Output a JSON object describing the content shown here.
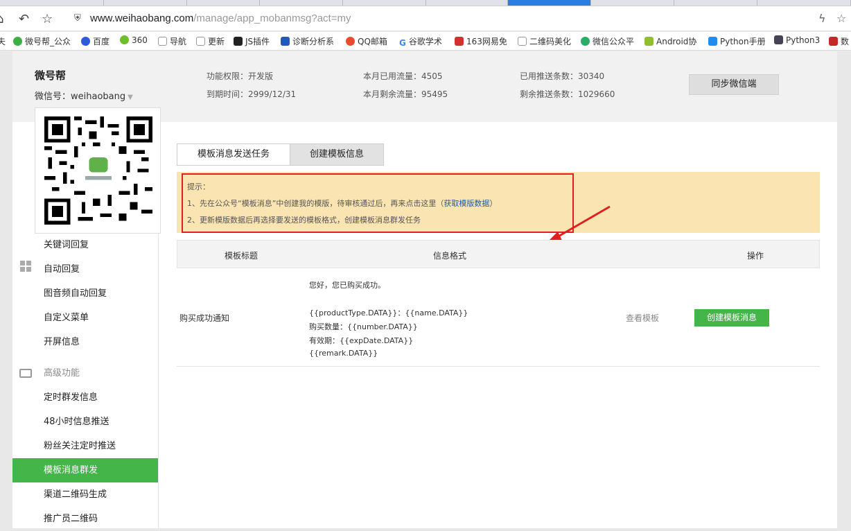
{
  "browser": {
    "url_host": "www.weihaobang.com",
    "url_path": "/manage/app_mobanmsg?act=my",
    "bookmarks": [
      "微号帮_公众",
      "百度",
      "360",
      "导航",
      "更新",
      "JS插件",
      "诊断分析系",
      "QQ邮箱",
      "谷歌学术",
      "163网易免",
      "二维码美化",
      "微信公众平",
      "Android协",
      "Python手册",
      "Python3",
      "数"
    ]
  },
  "header": {
    "brand": "微号帮",
    "wechat_id": "微信号：weihaobang",
    "permission": "功能权限：开发版",
    "expiry": "到期时间：2999/12/31",
    "used_traffic": "本月已用流量：4505",
    "remaining_traffic": "本月剩余流量：95495",
    "used_push": "已用推送条数：30340",
    "remaining_push": "剩余推送条数：1029660",
    "sync_button": "同步微信端"
  },
  "sidebar": {
    "items_top": [
      "关键词回复",
      "自动回复",
      "图音频自动回复",
      "自定义菜单",
      "开屏信息"
    ],
    "group_label": "高级功能",
    "items_advanced": [
      "定时群发信息",
      "48小时信息推送",
      "粉丝关注定时推送",
      "模板消息群发",
      "渠道二维码生成",
      "推广员二维码"
    ],
    "active_item": "模板消息群发"
  },
  "tabs": [
    "模板消息发送任务",
    "创建模板信息"
  ],
  "tip": {
    "heading": "提示：",
    "line1_before": "1、先在公众号“模板消息”中创建我的模版，待审核通过后，再来点击这里（",
    "line1_link": "获取模版数据",
    "line1_after": "）",
    "line2": "2、更新模版数据后再选择要发送的模板格式，创建模板消息群发任务"
  },
  "table": {
    "headers": [
      "模板标题",
      "信息格式",
      "操作"
    ],
    "rows": [
      {
        "title": "购买成功通知",
        "format": [
          "您好，您已购买成功。",
          "{{productType.DATA}}：{{name.DATA}}",
          "购买数量：{{number.DATA}}",
          "有效期：{{expDate.DATA}}",
          "{{remark.DATA}}"
        ],
        "view": "查看模板",
        "create": "创建模板消息"
      }
    ]
  },
  "colors": {
    "accent": "#44b549",
    "tip_bg": "#fae4b1",
    "highlight": "#e02020"
  }
}
